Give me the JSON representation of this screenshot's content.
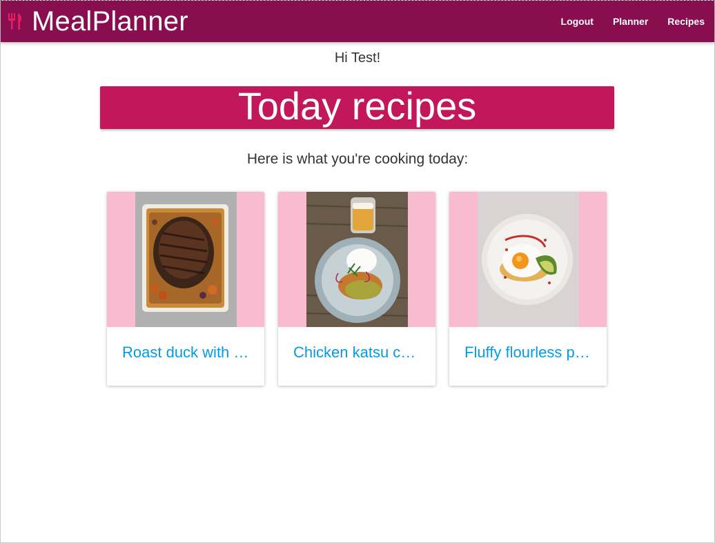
{
  "app": {
    "title": "MealPlanner",
    "brand_icon": "fork-knife-icon",
    "accent_color": "#880e4f"
  },
  "nav": {
    "items": [
      {
        "label": "Logout"
      },
      {
        "label": "Planner"
      },
      {
        "label": "Recipes"
      }
    ]
  },
  "greeting": "Hi Test!",
  "banner": {
    "title": "Today recipes",
    "color": "#c2185b"
  },
  "subtitle": "Here is what you're cooking today:",
  "recipes": [
    {
      "title": "Roast duck with …",
      "image": "roast-duck-photo"
    },
    {
      "title": "Chicken katsu cu…",
      "image": "chicken-katsu-photo"
    },
    {
      "title": "Fluffy flourless p…",
      "image": "fluffy-pancake-photo"
    }
  ],
  "card_media_bg": "#f8bbd0",
  "link_color": "#039be5"
}
